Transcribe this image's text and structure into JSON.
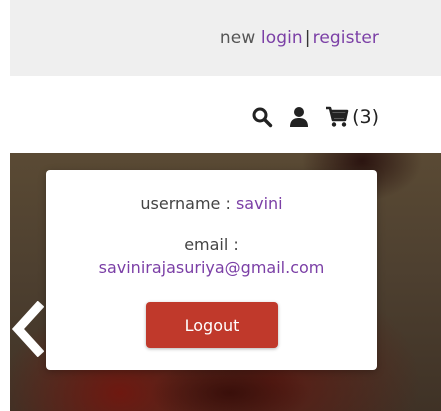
{
  "header": {
    "prefix_text": "new",
    "login_label": "login",
    "separator": "|",
    "register_label": "register"
  },
  "icons": {
    "search": "search-icon",
    "user": "user-icon",
    "cart": "cart-icon",
    "cart_count": "(3)"
  },
  "popup": {
    "username_label": "username :",
    "username_value": "savini",
    "email_label": "email :",
    "email_value": "savinirajasuriya@gmail.com",
    "logout_label": "Logout"
  },
  "colors": {
    "link": "#7b3fa6",
    "logout_button": "#c0392b",
    "top_bar": "#efefef"
  }
}
